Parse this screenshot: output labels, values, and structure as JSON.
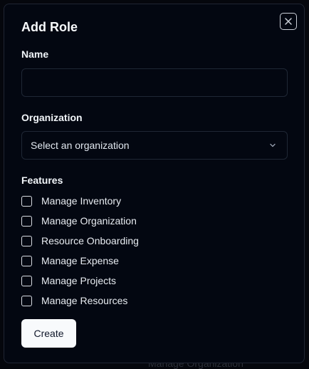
{
  "background": {
    "ghost_text": "Manage Organization"
  },
  "dialog": {
    "title": "Add Role",
    "close_icon": "close-icon",
    "name": {
      "label": "Name",
      "value": "",
      "placeholder": ""
    },
    "organization": {
      "label": "Organization",
      "selected": "Select an organization",
      "icon": "chevron-down-icon"
    },
    "features": {
      "label": "Features",
      "items": [
        {
          "label": "Manage Inventory",
          "checked": false
        },
        {
          "label": "Manage Organization",
          "checked": false
        },
        {
          "label": "Resource Onboarding",
          "checked": false
        },
        {
          "label": "Manage Expense",
          "checked": false
        },
        {
          "label": "Manage Projects",
          "checked": false
        },
        {
          "label": "Manage Resources",
          "checked": false
        }
      ]
    },
    "create_label": "Create"
  },
  "colors": {
    "dialog_bg": "#030711",
    "border": "#1f2735",
    "text": "#f8fafc",
    "button_bg": "#f8fafc",
    "button_text": "#0f172a"
  }
}
